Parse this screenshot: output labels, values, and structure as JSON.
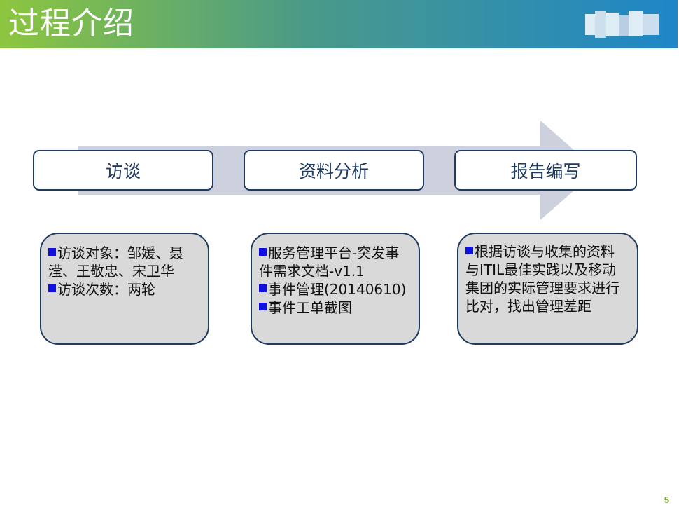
{
  "slide": {
    "title": "过程介绍",
    "page_number": "5",
    "colors": {
      "header_start": "#8dc63f",
      "header_end": "#1f86c8",
      "step_border": "#1f3a60",
      "detail_fill": "#d9d9d9",
      "arrow_fill": "#cdd1de",
      "bullet": "#1010e0"
    }
  },
  "steps": [
    {
      "label": "访谈"
    },
    {
      "label": "资料分析"
    },
    {
      "label": "报告编写"
    }
  ],
  "details": [
    {
      "lines": [
        {
          "text": "访谈对象：邹媛、聂",
          "bullet": true
        },
        {
          "text": "滢、王敬忠、宋卫华",
          "bullet": false
        },
        {
          "text": "访谈次数：两轮",
          "bullet": true
        }
      ]
    },
    {
      "lines": [
        {
          "text": "服务管理平台-突发事",
          "bullet": true
        },
        {
          "text": "件需求文档-v1.1",
          "bullet": false
        },
        {
          "text": "事件管理(20140610)",
          "bullet": true
        },
        {
          "text": "事件工单截图",
          "bullet": true
        }
      ]
    },
    {
      "lines": [
        {
          "text": "根据访谈与收集的资料",
          "bullet": true
        },
        {
          "text": "与ITIL最佳实践以及移动",
          "bullet": false
        },
        {
          "text": "集团的实际管理要求进行",
          "bullet": false
        },
        {
          "text": "比对，找出管理差距",
          "bullet": false
        }
      ]
    }
  ]
}
